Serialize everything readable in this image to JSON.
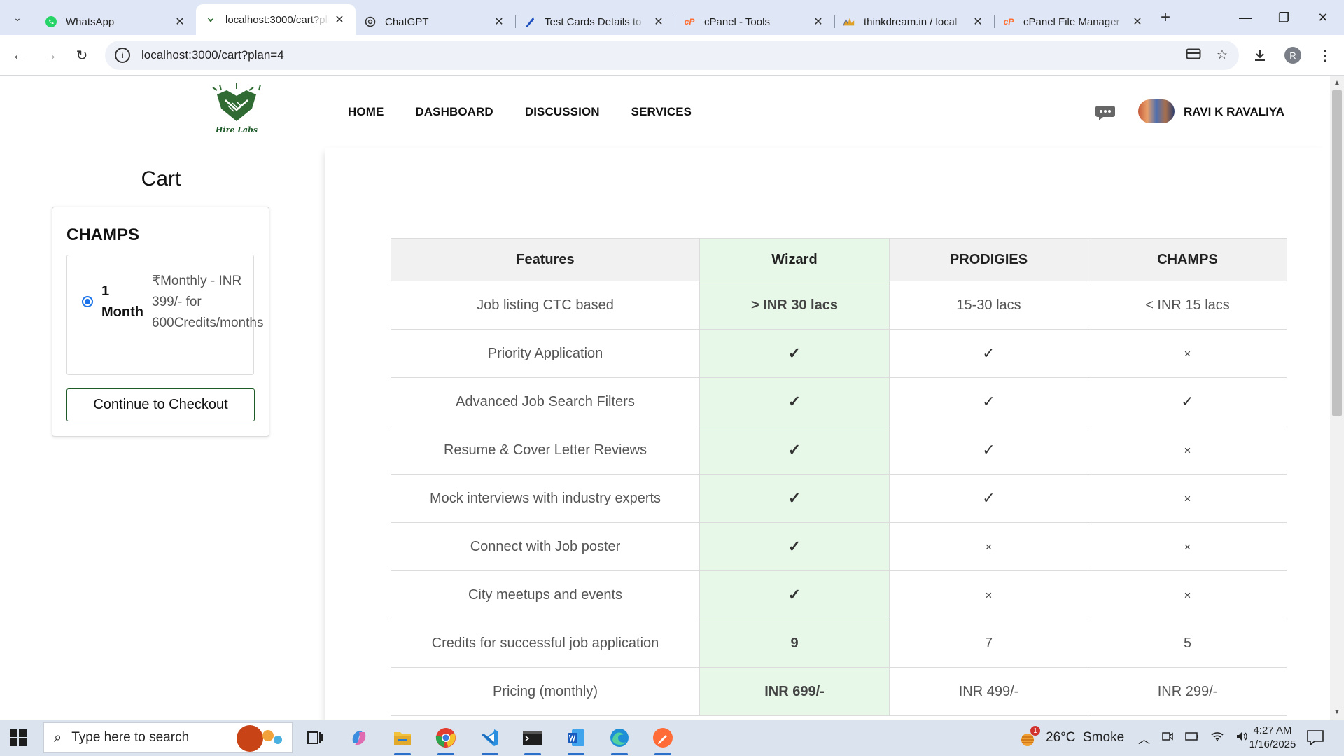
{
  "browser": {
    "tabs": [
      {
        "title": "WhatsApp",
        "favicon": "whatsapp-icon",
        "active": false
      },
      {
        "title": "localhost:3000/cart?plan=4",
        "favicon": "hirelabs-icon",
        "active": true
      },
      {
        "title": "ChatGPT",
        "favicon": "chatgpt-icon",
        "active": false
      },
      {
        "title": "Test Cards Details to",
        "favicon": "stripe-icon",
        "active": false
      },
      {
        "title": "cPanel - Tools",
        "favicon": "cpanel-icon",
        "active": false
      },
      {
        "title": "thinkdream.in / local",
        "favicon": "phpmyadmin-icon",
        "active": false
      },
      {
        "title": "cPanel File Manager",
        "favicon": "cpanel-icon",
        "active": false
      }
    ],
    "url": "localhost:3000/cart?plan=4",
    "profile_initial": "R"
  },
  "site": {
    "logo_text": "Hire Labs",
    "nav": [
      "HOME",
      "DASHBOARD",
      "DISCUSSION",
      "SERVICES"
    ],
    "username": "RAVI K RAVALIYA"
  },
  "cart": {
    "title": "Cart",
    "plan_name": "CHAMPS",
    "option_duration": "1 Month",
    "option_description": "₹Monthly - INR 399/- for 600Credits/months",
    "checkout_label": "Continue to Checkout"
  },
  "features_table": {
    "headers": [
      "Features",
      "Wizard",
      "PRODIGIES",
      "CHAMPS"
    ],
    "rows": [
      [
        "Job listing CTC based",
        "> INR 30 lacs",
        "15-30 lacs",
        "< INR 15 lacs"
      ],
      [
        "Priority Application",
        "✓",
        "✓",
        "×"
      ],
      [
        "Advanced Job Search Filters",
        "✓",
        "✓",
        "✓"
      ],
      [
        "Resume & Cover Letter Reviews",
        "✓",
        "✓",
        "×"
      ],
      [
        "Mock interviews with industry experts",
        "✓",
        "✓",
        "×"
      ],
      [
        "Connect with Job poster",
        "✓",
        "×",
        "×"
      ],
      [
        "City meetups and events",
        "✓",
        "×",
        "×"
      ],
      [
        "Credits for successful job application",
        "9",
        "7",
        "5"
      ],
      [
        "Pricing (monthly)",
        "INR 699/-",
        "INR 499/-",
        "INR 299/-"
      ]
    ],
    "highlight_color": "#e7f8e8"
  },
  "taskbar": {
    "search_placeholder": "Type here to search",
    "weather": "26°C  Smoke",
    "weather_badge": "1",
    "time": "4:27 AM",
    "date": "1/16/2025"
  }
}
